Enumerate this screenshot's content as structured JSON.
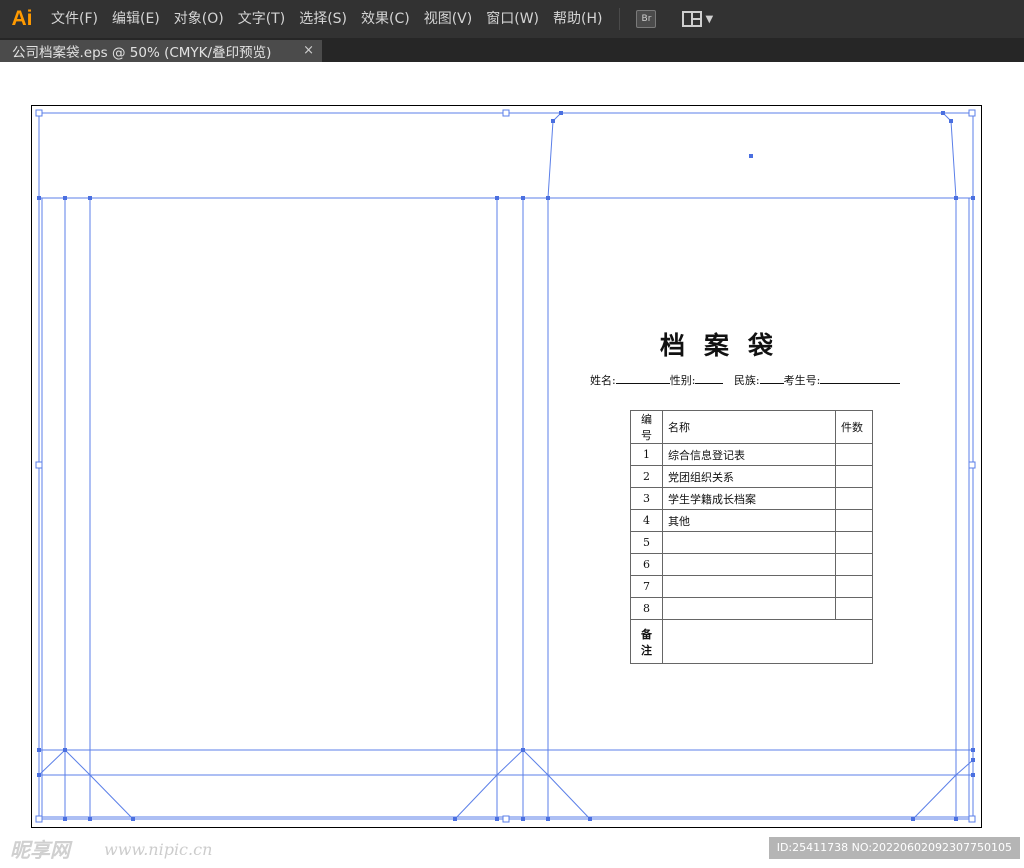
{
  "app": {
    "logo": "Ai"
  },
  "menu": [
    {
      "label": "文件(F)"
    },
    {
      "label": "编辑(E)"
    },
    {
      "label": "对象(O)"
    },
    {
      "label": "文字(T)"
    },
    {
      "label": "选择(S)"
    },
    {
      "label": "效果(C)"
    },
    {
      "label": "视图(V)"
    },
    {
      "label": "窗口(W)"
    },
    {
      "label": "帮助(H)"
    }
  ],
  "toolbar": {
    "bridge_label": "Br",
    "arrange_icon": "arrange-documents-icon"
  },
  "tab": {
    "title": "公司档案袋.eps @ 50% (CMYK/叠印预览)",
    "close": "×"
  },
  "document": {
    "title": "档案袋",
    "info": {
      "name_label": "姓名:",
      "gender_label": "性别:",
      "ethnicity_label": "民族:",
      "exam_label": "考生号:"
    },
    "table": {
      "headers": [
        "编号",
        "名称",
        "件数"
      ],
      "rows": [
        {
          "no": "1",
          "name": "综合信息登记表",
          "count": ""
        },
        {
          "no": "2",
          "name": "党团组织关系",
          "count": ""
        },
        {
          "no": "3",
          "name": "学生学籍成长档案",
          "count": ""
        },
        {
          "no": "4",
          "name": "其他",
          "count": ""
        },
        {
          "no": "5",
          "name": "",
          "count": ""
        },
        {
          "no": "6",
          "name": "",
          "count": ""
        },
        {
          "no": "7",
          "name": "",
          "count": ""
        },
        {
          "no": "8",
          "name": "",
          "count": ""
        }
      ],
      "remarks_label": "备注"
    }
  },
  "watermark": {
    "logo": "昵享网",
    "url": "www.nipic.cn",
    "id": "ID:25411738 NO:20220602092307750105"
  },
  "colors": {
    "menubar_bg": "#323232",
    "logo": "#ff9a00",
    "guide": "#5b7fe8",
    "anchor": "#4a6fe0"
  }
}
